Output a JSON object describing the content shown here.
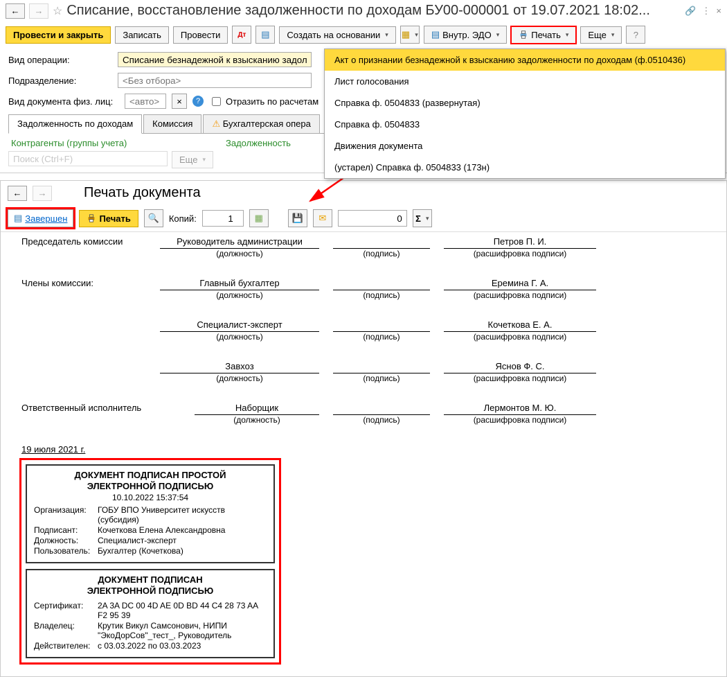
{
  "win1": {
    "title": "Списание, восстановление задолженности по доходам БУ00-000001 от 19.07.2021 18:02...",
    "toolbar": {
      "post_close": "Провести и закрыть",
      "save": "Записать",
      "post": "Провести",
      "create_based": "Создать на основании",
      "edo": "Внутр. ЭДО",
      "print": "Печать",
      "more": "Еще"
    },
    "print_menu": [
      "Акт о признании безнадежной к взысканию задолженности по доходам (ф.0510436)",
      "Лист голосования",
      "Справка ф. 0504833 (развернутая)",
      "Справка ф. 0504833",
      "Движения документа",
      "(устарел) Справка ф. 0504833 (173н)"
    ],
    "form": {
      "op_type_label": "Вид операции:",
      "op_type_value": "Списание безнадежной к взысканию задолж",
      "dept_label": "Подразделение:",
      "dept_placeholder": "<Без отбора>",
      "doc_type_label": "Вид документа физ. лиц:",
      "doc_type_placeholder": "<авто>",
      "reflect_label": "Отразить по расчетам"
    },
    "tabs": {
      "t1": "Задолженность по доходам",
      "t2": "Комиссия",
      "t3": "Бухгалтерская опера"
    },
    "sub": {
      "col1": "Контрагенты (группы учета)",
      "col2": "Задолженность",
      "search_placeholder": "Поиск (Ctrl+F)",
      "more": "Еще"
    }
  },
  "win2": {
    "title": "Печать документа",
    "toolbar": {
      "complete": "Завершен",
      "print": "Печать",
      "copies_label": "Копий:",
      "copies_value": "1",
      "num_value": "0"
    },
    "doc": {
      "chairman_label": "Председатель комиссии",
      "members_label": "Члены комиссии:",
      "responsible_label": "Ответственный исполнитель",
      "caption_position": "(должность)",
      "caption_signature": "(подпись)",
      "caption_name": "(расшифровка подписи)",
      "rows": [
        {
          "position": "Руководитель администрации",
          "name": "Петров П. И."
        },
        {
          "position": "Главный бухгалтер",
          "name": "Еремина Г. А."
        },
        {
          "position": "Специалист-эксперт",
          "name": "Кочеткова Е. А."
        },
        {
          "position": "Завхоз",
          "name": "Яснов Ф. С."
        },
        {
          "position": "Наборщик",
          "name": "Лермонтов М. Ю."
        }
      ],
      "date": "19 июля 2021 г."
    },
    "stamp1": {
      "title1": "ДОКУМЕНТ ПОДПИСАН ПРОСТОЙ",
      "title2": "ЭЛЕКТРОННОЙ ПОДПИСЬЮ",
      "time": "10.10.2022 15:37:54",
      "org_k": "Организация:",
      "org_v": "ГОБУ ВПО Университет искусств (субсидия)",
      "signer_k": "Подписант:",
      "signer_v": "Кочеткова Елена Александровна",
      "pos_k": "Должность:",
      "pos_v": "Специалист-эксперт",
      "user_k": "Пользователь:",
      "user_v": "Бухгалтер (Кочеткова)"
    },
    "stamp2": {
      "title1": "ДОКУМЕНТ ПОДПИСАН",
      "title2": "ЭЛЕКТРОННОЙ ПОДПИСЬЮ",
      "cert_k": "Сертификат:",
      "cert_v": "2A 3A DC 00 4D AE 0D BD 44 C4 28 73 AA F2 95 39",
      "owner_k": "Владелец:",
      "owner_v": "Крутик Викул Самсонович, НИПИ \"ЭкоДорСов\"_тест_, Руководитель",
      "valid_k": "Действителен:",
      "valid_v": "с 03.03.2022 по 03.03.2023"
    }
  }
}
